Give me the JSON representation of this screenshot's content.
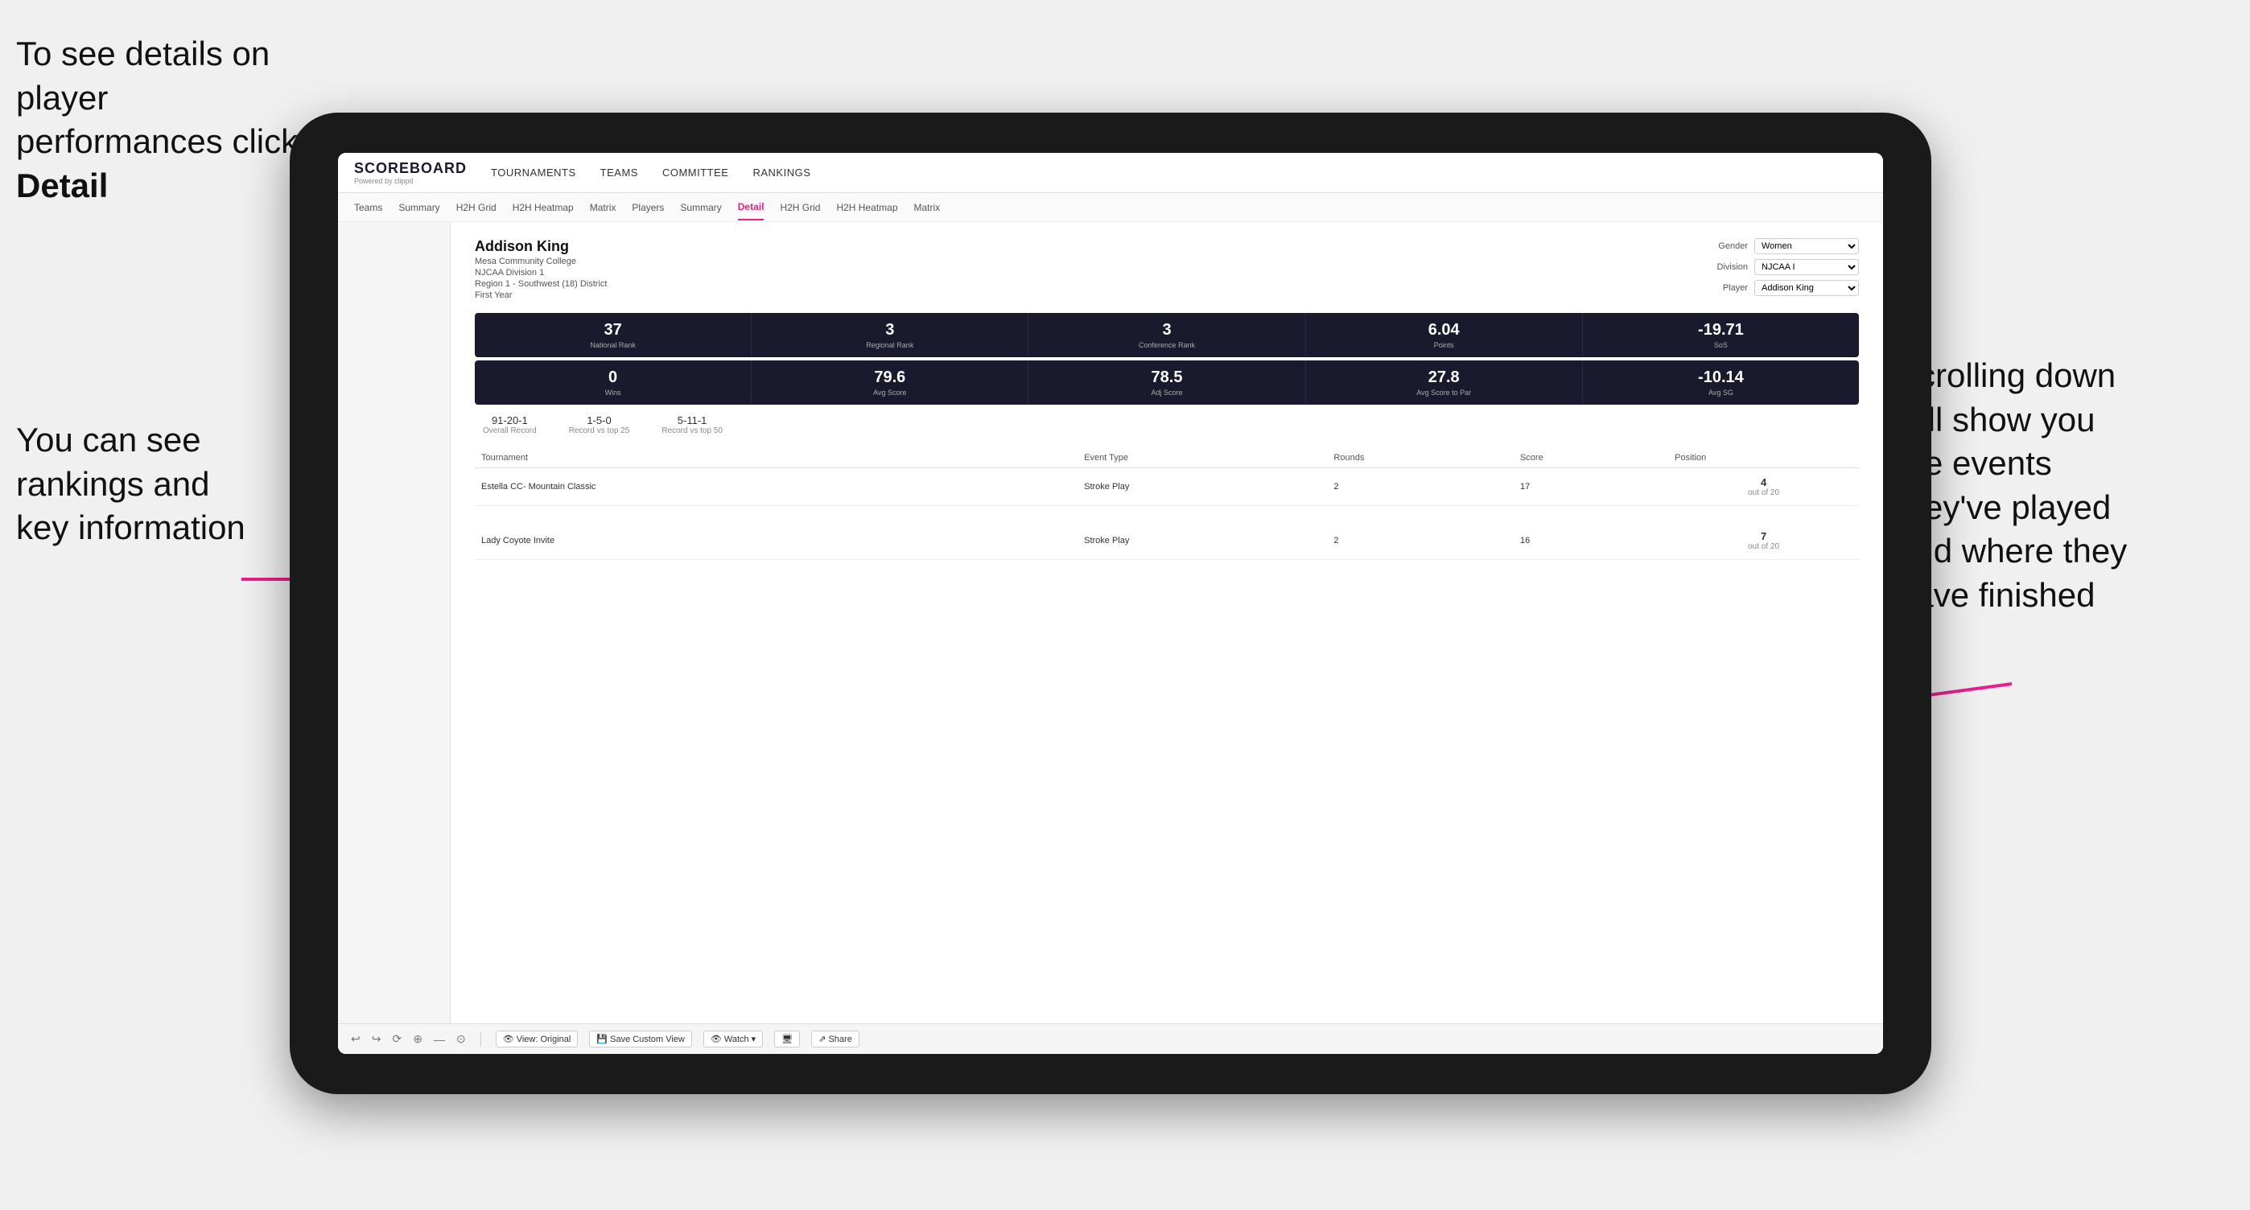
{
  "annotations": {
    "top_left": "To see details on player performances click ",
    "top_left_bold": "Detail",
    "bottom_left_line1": "You can see",
    "bottom_left_line2": "rankings and",
    "bottom_left_line3": "key information",
    "right_line1": "Scrolling down",
    "right_line2": "will show you",
    "right_line3": "the events",
    "right_line4": "they've played",
    "right_line5": "and where they",
    "right_line6": "have finished"
  },
  "nav": {
    "logo": "SCOREBOARD",
    "logo_sub": "Powered by clippd",
    "items": [
      "TOURNAMENTS",
      "TEAMS",
      "COMMITTEE",
      "RANKINGS"
    ]
  },
  "sub_nav": {
    "items": [
      "Teams",
      "Summary",
      "H2H Grid",
      "H2H Heatmap",
      "Matrix",
      "Players",
      "Summary",
      "Detail",
      "H2H Grid",
      "H2H Heatmap",
      "Matrix"
    ],
    "active": "Detail"
  },
  "player": {
    "name": "Addison King",
    "college": "Mesa Community College",
    "division": "NJCAA Division 1",
    "region": "Region 1 - Southwest (18) District",
    "year": "First Year",
    "gender_label": "Gender",
    "gender_value": "Women",
    "division_label": "Division",
    "division_value": "NJCAA I",
    "player_label": "Player",
    "player_value": "Addison King"
  },
  "stats_row1": [
    {
      "value": "37",
      "label": "National Rank"
    },
    {
      "value": "3",
      "label": "Regional Rank"
    },
    {
      "value": "3",
      "label": "Conference Rank"
    },
    {
      "value": "6.04",
      "label": "Points"
    },
    {
      "value": "-19.71",
      "label": "SoS"
    }
  ],
  "stats_row2": [
    {
      "value": "0",
      "label": "Wins"
    },
    {
      "value": "79.6",
      "label": "Avg Score"
    },
    {
      "value": "78.5",
      "label": "Adj Score"
    },
    {
      "value": "27.8",
      "label": "Avg Score to Par"
    },
    {
      "value": "-10.14",
      "label": "Avg SG"
    }
  ],
  "records": [
    {
      "value": "91-20-1",
      "label": "Overall Record"
    },
    {
      "value": "1-5-0",
      "label": "Record vs top 25"
    },
    {
      "value": "5-11-1",
      "label": "Record vs top 50"
    }
  ],
  "table": {
    "headers": [
      "Tournament",
      "",
      "Event Type",
      "Rounds",
      "Score",
      "Position"
    ],
    "rows": [
      {
        "tournament": "Estella CC- Mountain Classic",
        "event_type": "Stroke Play",
        "rounds": "2",
        "score": "17",
        "position": "4",
        "position_sub": "out of 20"
      },
      {
        "tournament": "Lady Coyote Invite",
        "event_type": "Stroke Play",
        "rounds": "2",
        "score": "16",
        "position": "7",
        "position_sub": "out of 20"
      }
    ]
  },
  "toolbar": {
    "buttons": [
      "View: Original",
      "Save Custom View",
      "Watch",
      "Share"
    ],
    "icons": [
      "↩",
      "↪",
      "⟳",
      "⊕",
      "—",
      "⊙"
    ]
  }
}
